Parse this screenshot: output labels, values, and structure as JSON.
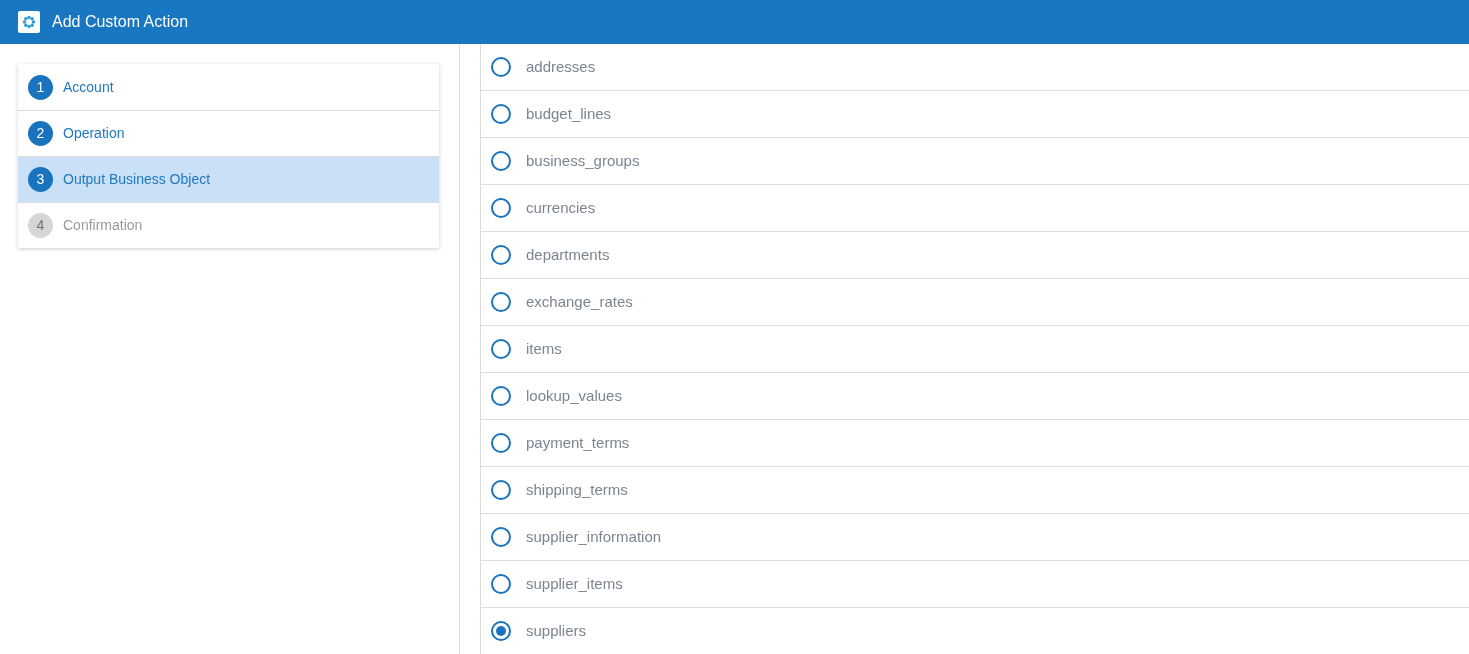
{
  "window": {
    "title": "Add Custom Action"
  },
  "steps": [
    {
      "number": "1",
      "label": "Account",
      "selected": false,
      "disabled": false
    },
    {
      "number": "2",
      "label": "Operation",
      "selected": false,
      "disabled": false
    },
    {
      "number": "3",
      "label": "Output Business Object",
      "selected": true,
      "disabled": false
    },
    {
      "number": "4",
      "label": "Confirmation",
      "selected": false,
      "disabled": true
    }
  ],
  "objects": [
    {
      "label": "addresses",
      "selected": false
    },
    {
      "label": "budget_lines",
      "selected": false
    },
    {
      "label": "business_groups",
      "selected": false
    },
    {
      "label": "currencies",
      "selected": false
    },
    {
      "label": "departments",
      "selected": false
    },
    {
      "label": "exchange_rates",
      "selected": false
    },
    {
      "label": "items",
      "selected": false
    },
    {
      "label": "lookup_values",
      "selected": false
    },
    {
      "label": "payment_terms",
      "selected": false
    },
    {
      "label": "shipping_terms",
      "selected": false
    },
    {
      "label": "supplier_information",
      "selected": false
    },
    {
      "label": "supplier_items",
      "selected": false
    },
    {
      "label": "suppliers",
      "selected": true
    }
  ]
}
